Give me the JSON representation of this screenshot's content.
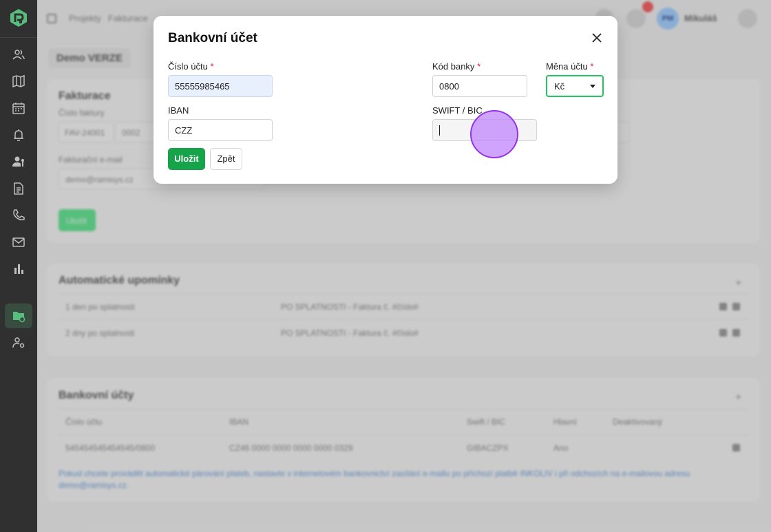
{
  "sidebar": {
    "items": [
      {
        "icon": "users-icon"
      },
      {
        "icon": "map-icon"
      },
      {
        "icon": "calendar-icon"
      },
      {
        "icon": "bell-icon"
      },
      {
        "icon": "user-key-icon"
      },
      {
        "icon": "document-icon"
      },
      {
        "icon": "phone-icon"
      },
      {
        "icon": "mail-icon"
      },
      {
        "icon": "chart-icon"
      },
      {
        "icon": "folder-settings-icon",
        "active": true
      },
      {
        "icon": "user-settings-icon"
      }
    ]
  },
  "background": {
    "breadcrumb": [
      "Projekty",
      "Fakturace"
    ],
    "user_initials": "PM",
    "user_name": "Mikuláš",
    "page_tag": "Demo VERZE",
    "fakturace": {
      "title": "Fakturace",
      "invoice_number_label": "Číslo faktury",
      "invoice_prefix": "FAV-24001",
      "invoice_digits": "0002",
      "email_label": "Fakturační e-mail",
      "email_value": "demo@ramisys.cz",
      "save_label": "Uložit"
    },
    "reminders": {
      "title": "Automatické upomínky",
      "rows": [
        {
          "when": "1 den po splatnosti",
          "subject": "PO SPLATNOSTI - Faktura č. #číslo#"
        },
        {
          "when": "2 dny po splatnosti",
          "subject": "PO SPLATNOSTI - Faktura č. #číslo#"
        }
      ]
    },
    "bank_accounts": {
      "title": "Bankovní účty",
      "columns": [
        "Číslo účtu",
        "IBAN",
        "Swift / BIC",
        "Hlavní",
        "Deaktivovaný"
      ],
      "rows": [
        {
          "account": "545454545454545/0800",
          "iban": "CZ46 0000 0000 0000 0000 0329",
          "swift": "GIBACZPX",
          "main": "Ano"
        }
      ],
      "note": "Pokud chcete provádět automatické párování plateb, nastavte v internetovém bankovnictví zasílání e-mailu po příchozí platbě INKOLIV i při odchozích na e-mailovou adresu demo@ramisys.cz."
    }
  },
  "modal": {
    "title": "Bankovní účet",
    "account_number": {
      "label": "Číslo účtu",
      "required_mark": "*",
      "value": "55555985465"
    },
    "bank_code": {
      "label": "Kód banky",
      "required_mark": "*",
      "value": "0800"
    },
    "currency": {
      "label": "Měna účtu",
      "required_mark": "*",
      "value": "Kč"
    },
    "iban": {
      "label": "IBAN",
      "value": "CZZ"
    },
    "swift": {
      "label": "SWIFT / BIC",
      "value": ""
    },
    "save_label": "Uložit",
    "back_label": "Zpět"
  },
  "colors": {
    "accent_green": "#16a34a",
    "sidebar_bg": "#121212",
    "required_red": "#e11d48",
    "click_marker": "#c084fc"
  }
}
